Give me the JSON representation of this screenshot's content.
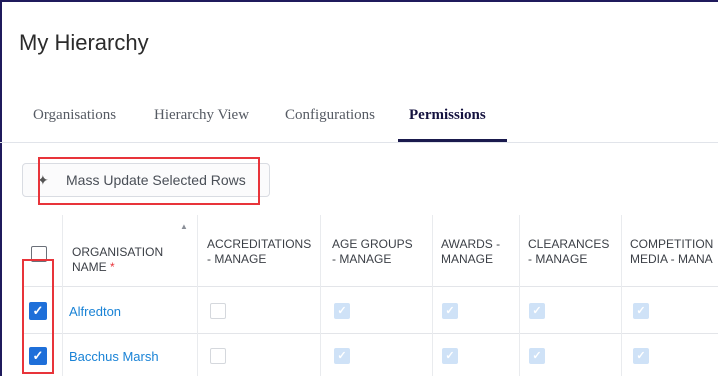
{
  "page": {
    "title": "My Hierarchy"
  },
  "tabs": [
    {
      "label": "Organisations",
      "active": false
    },
    {
      "label": "Hierarchy View",
      "active": false
    },
    {
      "label": "Configurations",
      "active": false
    },
    {
      "label": "Permissions",
      "active": true
    }
  ],
  "toolbar": {
    "mass_update_label": "Mass Update Selected Rows",
    "mass_update_icon": "magic-wand-icon"
  },
  "table": {
    "columns": [
      {
        "line1": "ORGANISATION",
        "line2": "NAME",
        "required_mark": "*"
      },
      {
        "line1": "ACCREDITATIONS",
        "line2": "- MANAGE"
      },
      {
        "line1": "AGE GROUPS",
        "line2": "- MANAGE"
      },
      {
        "line1": "AWARDS -",
        "line2": "MANAGE"
      },
      {
        "line1": "CLEARANCES",
        "line2": "- MANAGE"
      },
      {
        "line1": "COMPETITION",
        "line2": "MEDIA - MANA"
      }
    ],
    "rows": [
      {
        "selected": true,
        "name": "Alfredton",
        "permissions": [
          false,
          true,
          true,
          true,
          true
        ]
      },
      {
        "selected": true,
        "name": "Bacchus Marsh",
        "permissions": [
          false,
          true,
          true,
          true,
          true
        ]
      }
    ]
  },
  "colors": {
    "accent": "#1e6fd9",
    "link": "#1a83d6",
    "highlight": "#e8343a",
    "active_tab": "#14123f"
  }
}
